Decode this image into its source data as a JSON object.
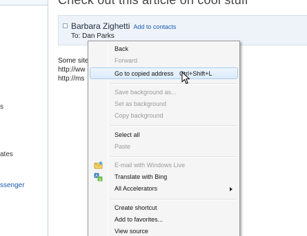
{
  "left_pane": {
    "items": [
      {
        "label": "s",
        "link": false
      },
      {
        "label": "ates",
        "link": false
      },
      {
        "label": "ssenger",
        "link": true
      }
    ]
  },
  "message": {
    "subject": "Check out this article on cool stuff",
    "sender_name": "Barbara Zighetti",
    "add_contacts": "Add to contacts",
    "to_line": "To: Dan Parks",
    "body_lines": [
      "Some site",
      "http://ww",
      "http://ms"
    ]
  },
  "context_menu": {
    "highlighted_index": 2,
    "items": [
      {
        "label": "Back",
        "disabled": false
      },
      {
        "label": "Forward",
        "disabled": true
      },
      {
        "label": "Go to copied address",
        "shortcut": "Ctrl+Shift+L",
        "disabled": false
      },
      {
        "label": "Save background as...",
        "disabled": true
      },
      {
        "label": "Set as background",
        "disabled": true
      },
      {
        "label": "Copy background",
        "disabled": true
      },
      {
        "label": "Select all",
        "disabled": false
      },
      {
        "label": "Paste",
        "disabled": true
      },
      {
        "label": "E-mail with Windows Live",
        "disabled": true,
        "icon": "windows-live-mail-icon"
      },
      {
        "label": "Translate with Bing",
        "disabled": false,
        "icon": "bing-translate-icon"
      },
      {
        "label": "All Accelerators",
        "disabled": false,
        "submenu": true
      },
      {
        "label": "Create shortcut",
        "disabled": false
      },
      {
        "label": "Add to favorites...",
        "disabled": false
      },
      {
        "label": "View source",
        "disabled": false
      }
    ]
  },
  "icons": {
    "cursor": "mouse-pointer-icon",
    "email": "windows-live-mail-icon",
    "translate": "bing-translate-icon",
    "submenu": "submenu-arrow-icon"
  },
  "colors": {
    "link": "#1a5bb0",
    "header_bg": "#eef3fa",
    "menu_bg": "#f5f5f5",
    "menu_highlight_border": "#a8cdf1",
    "disabled_text": "#9a9a9a"
  }
}
